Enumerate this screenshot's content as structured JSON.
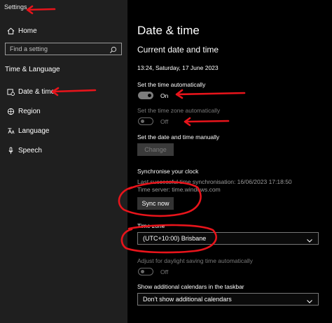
{
  "window": {
    "title": "Settings"
  },
  "sidebar": {
    "home_label": "Home",
    "search_placeholder": "Find a setting",
    "section_label": "Time & Language",
    "items": [
      {
        "label": "Date & time",
        "icon": "calendar-clock-icon"
      },
      {
        "label": "Region",
        "icon": "globe-icon"
      },
      {
        "label": "Language",
        "icon": "language-icon"
      },
      {
        "label": "Speech",
        "icon": "microphone-icon"
      }
    ]
  },
  "main": {
    "page_title": "Date & time",
    "current_heading": "Current date and time",
    "current_datetime": "13:24, Saturday, 17 June 2023",
    "set_time_auto": {
      "label": "Set the time automatically",
      "state": "On"
    },
    "set_timezone_auto": {
      "label": "Set the time zone automatically",
      "state": "Off"
    },
    "set_manual": {
      "label": "Set the date and time manually",
      "button": "Change"
    },
    "sync": {
      "heading": "Synchronise your clock",
      "last_sync": "Last successful time synchronisation: 16/06/2023 17:18:50",
      "server": "Time server: time.windows.com",
      "button": "Sync now"
    },
    "timezone": {
      "label": "Time zone",
      "value": "(UTC+10:00) Brisbane"
    },
    "dst": {
      "label": "Adjust for daylight saving time automatically",
      "state": "Off"
    },
    "calendars": {
      "label": "Show additional calendars in the taskbar",
      "value": "Don't show additional calendars"
    }
  },
  "colors": {
    "annotation": "#e8141b",
    "sidebar_bg": "#1f1f1f",
    "main_bg": "#000000"
  }
}
